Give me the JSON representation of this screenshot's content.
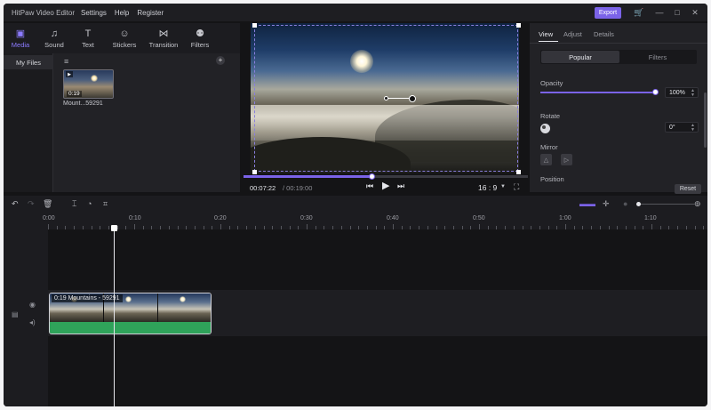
{
  "app": {
    "title": "HitPaw Video Editor",
    "menu": [
      "Settings",
      "Help",
      "Register"
    ],
    "export_label": "Export",
    "accent_color": "#7b63e8"
  },
  "media_tabs": [
    {
      "label": "Media",
      "icon": "media-icon",
      "active": true
    },
    {
      "label": "Sound",
      "icon": "music-note-icon"
    },
    {
      "label": "Text",
      "icon": "text-icon"
    },
    {
      "label": "Stickers",
      "icon": "smiley-icon"
    },
    {
      "label": "Transition",
      "icon": "bowtie-icon"
    },
    {
      "label": "Filters",
      "icon": "filter-circles-icon"
    }
  ],
  "library": {
    "folder": "My Files",
    "clip": {
      "name": "Mount...59291",
      "duration": "0:19"
    }
  },
  "preview": {
    "current_time": "00:07:22",
    "total_time": "/ 00:19:00",
    "aspect_ratio": "16 : 9",
    "progress": 0.45
  },
  "properties": {
    "tabs": [
      "View",
      "Adjust",
      "Details"
    ],
    "active_tab": "View",
    "segments": [
      "Popular",
      "Filters"
    ],
    "opacity_label": "Opacity",
    "opacity_value": "100%",
    "opacity_level": 1.0,
    "rotate_label": "Rotate",
    "rotate_value": "0°",
    "mirror_label": "Mirror",
    "position_label": "Position",
    "reset_label": "Reset"
  },
  "timeline": {
    "ruler": [
      "0:00",
      "0:10",
      "0:20",
      "0:30",
      "0:40",
      "0:50",
      "1:00",
      "1:10"
    ],
    "clip_label": "0:19   Mountains - 59291",
    "audio_color": "#2fa35a"
  }
}
